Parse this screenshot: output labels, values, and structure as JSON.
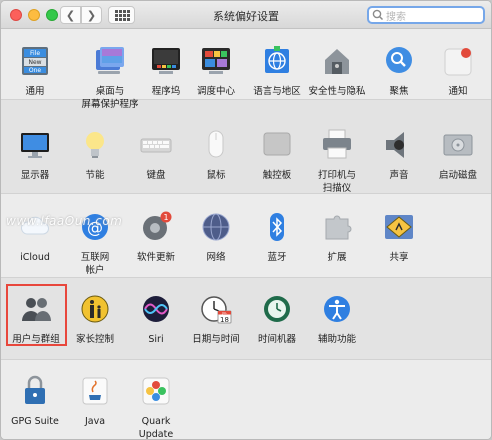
{
  "window": {
    "title": "系统偏好设置"
  },
  "search": {
    "placeholder": "搜索"
  },
  "watermark": "www.lfaaOun.com",
  "rows": [
    {
      "panes": [
        {
          "label": "通用",
          "icon": "general-icon"
        },
        {
          "label": "桌面与\n屏幕保护程序",
          "icon": "desktop-screensaver-icon"
        },
        {
          "label": "程序坞",
          "icon": "dock-icon"
        },
        {
          "label": "调度中心",
          "icon": "mission-control-icon"
        },
        {
          "label": "语言与地区",
          "icon": "language-region-icon"
        },
        {
          "label": "安全性与隐私",
          "icon": "security-privacy-icon"
        },
        {
          "label": "聚焦",
          "icon": "spotlight-icon"
        },
        {
          "label": "通知",
          "icon": "notifications-icon"
        }
      ]
    },
    {
      "panes": [
        {
          "label": "显示器",
          "icon": "displays-icon"
        },
        {
          "label": "节能",
          "icon": "energy-saver-icon"
        },
        {
          "label": "键盘",
          "icon": "keyboard-icon"
        },
        {
          "label": "鼠标",
          "icon": "mouse-icon"
        },
        {
          "label": "触控板",
          "icon": "trackpad-icon"
        },
        {
          "label": "打印机与\n扫描仪",
          "icon": "printers-scanners-icon"
        },
        {
          "label": "声音",
          "icon": "sound-icon"
        },
        {
          "label": "启动磁盘",
          "icon": "startup-disk-icon"
        }
      ]
    },
    {
      "panes": [
        {
          "label": "iCloud",
          "icon": "icloud-icon"
        },
        {
          "label": "互联网\n帐户",
          "icon": "internet-accounts-icon"
        },
        {
          "label": "软件更新",
          "icon": "software-update-icon",
          "badge": "1"
        },
        {
          "label": "网络",
          "icon": "network-icon"
        },
        {
          "label": "蓝牙",
          "icon": "bluetooth-icon"
        },
        {
          "label": "扩展",
          "icon": "extensions-icon"
        },
        {
          "label": "共享",
          "icon": "sharing-icon"
        }
      ]
    },
    {
      "panes": [
        {
          "label": "用户与群组",
          "icon": "users-groups-icon"
        },
        {
          "label": "家长控制",
          "icon": "parental-controls-icon"
        },
        {
          "label": "Siri",
          "icon": "siri-icon"
        },
        {
          "label": "日期与时间",
          "icon": "date-time-icon",
          "calendar_day": "18",
          "calendar_month": "JUL"
        },
        {
          "label": "时间机器",
          "icon": "time-machine-icon"
        },
        {
          "label": "辅助功能",
          "icon": "accessibility-icon"
        }
      ]
    },
    {
      "panes": [
        {
          "label": "GPG Suite",
          "icon": "gpg-suite-icon"
        },
        {
          "label": "Java",
          "icon": "java-icon"
        },
        {
          "label": "Quark\nUpdate",
          "icon": "quark-update-icon"
        }
      ]
    }
  ]
}
